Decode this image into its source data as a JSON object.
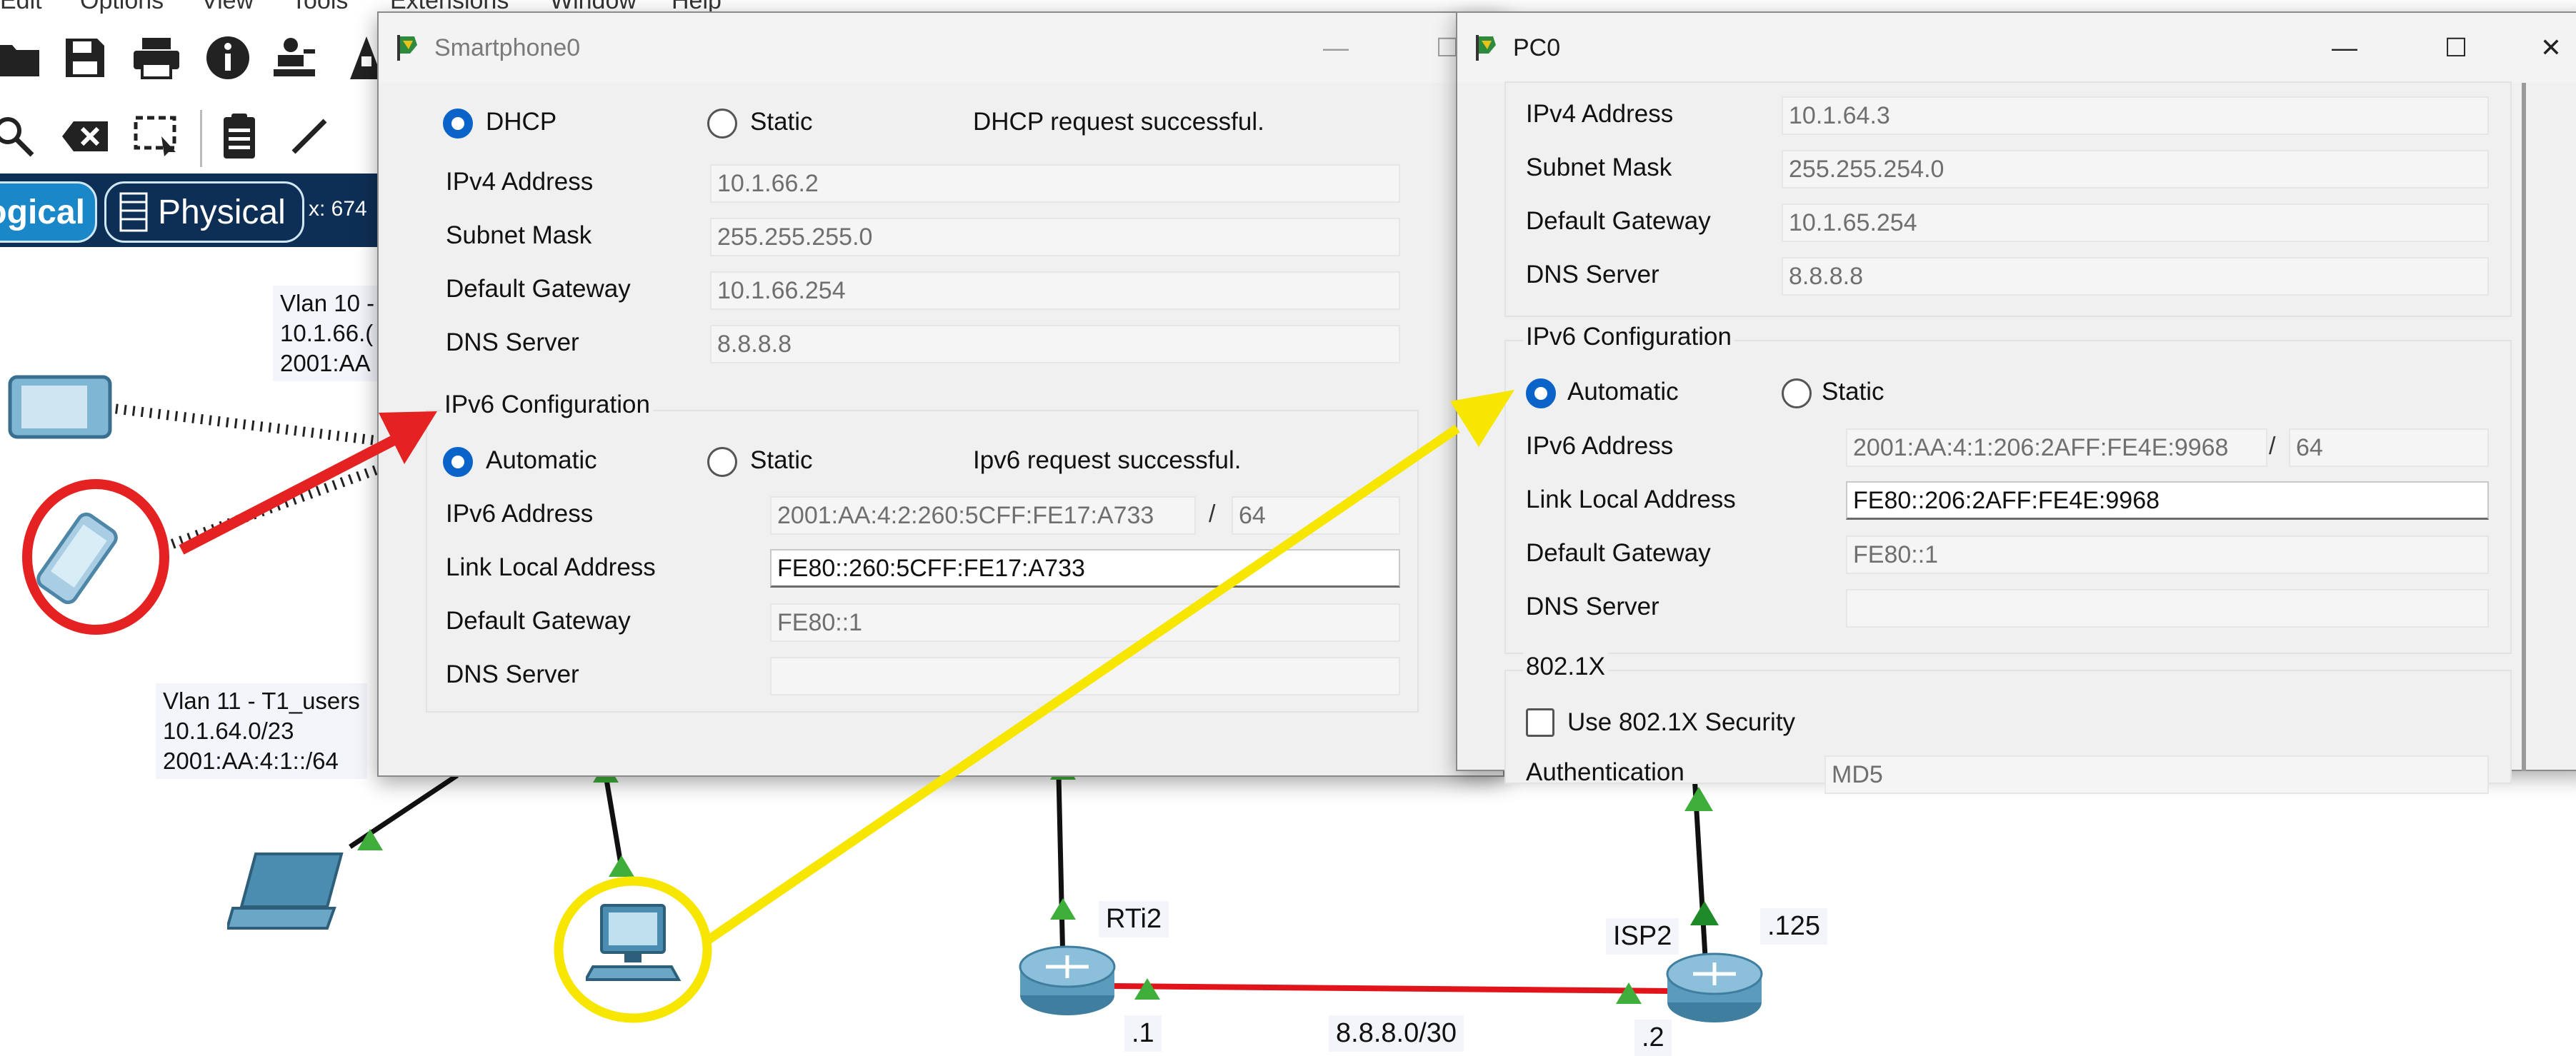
{
  "background_app": {
    "menu": [
      "Edit",
      "Options",
      "View",
      "Tools",
      "Extensions",
      "Window",
      "Help"
    ],
    "toolbar_icons": [
      "folder-icon",
      "save-icon",
      "print-icon",
      "info-icon",
      "network-wizard-icon",
      "palette-icon"
    ],
    "toolbar2_icons": [
      "zoom-icon",
      "delete-icon",
      "select-icon",
      "note-icon",
      "line-icon"
    ],
    "view_tabs": {
      "logical": "ogical",
      "physical": "Physical"
    },
    "coord_readout": "x: 674",
    "notes": [
      {
        "name": "vlan10-note",
        "text": "Vlan 10 -\n10.1.66.(\n2001:AA"
      },
      {
        "name": "vlan11-note",
        "text": "Vlan 11 - T1_users\n10.1.64.0/23\n2001:AA:4:1::/64"
      }
    ],
    "labels": {
      "router1": "RTi2",
      "router2": "ISP2",
      "iface_125": ".125",
      "network": "8.8.8.0/30",
      "iface_1": ".1",
      "iface_2": ".2"
    },
    "link_colors": {
      "serial": "#e0141a",
      "ethernet": "#111111",
      "port_up": "#3fae3a",
      "callout_red": "#e52222",
      "callout_yellow": "#f6e600"
    }
  },
  "smartphone_window": {
    "title": "Smartphone0",
    "ipv4_mode": {
      "dhcp": "DHCP",
      "static": "Static",
      "selected": "DHCP",
      "status": "DHCP request successful."
    },
    "ipv4": {
      "address_label": "IPv4 Address",
      "address": "10.1.66.2",
      "mask_label": "Subnet Mask",
      "mask": "255.255.255.0",
      "gateway_label": "Default Gateway",
      "gateway": "10.1.66.254",
      "dns_label": "DNS Server",
      "dns": "8.8.8.8"
    },
    "ipv6_title": "IPv6 Configuration",
    "ipv6_mode": {
      "automatic": "Automatic",
      "static": "Static",
      "selected": "Automatic",
      "status": "Ipv6 request successful."
    },
    "ipv6": {
      "address_label": "IPv6 Address",
      "address": "2001:AA:4:2:260:5CFF:FE17:A733",
      "slash": "/",
      "prefix": "64",
      "link_local_label": "Link Local Address",
      "link_local": "FE80::260:5CFF:FE17:A733",
      "gateway_label": "Default Gateway",
      "gateway": "FE80::1",
      "dns_label": "DNS Server",
      "dns": ""
    }
  },
  "pc_window": {
    "title": "PC0",
    "ipv4": {
      "address_label": "IPv4 Address",
      "address": "10.1.64.3",
      "mask_label": "Subnet Mask",
      "mask": "255.255.254.0",
      "gateway_label": "Default Gateway",
      "gateway": "10.1.65.254",
      "dns_label": "DNS Server",
      "dns": "8.8.8.8"
    },
    "ipv6_title": "IPv6 Configuration",
    "ipv6_mode": {
      "automatic": "Automatic",
      "static": "Static",
      "selected": "Automatic"
    },
    "ipv6": {
      "address_label": "IPv6 Address",
      "address": "2001:AA:4:1:206:2AFF:FE4E:9968",
      "slash": "/",
      "prefix": "64",
      "link_local_label": "Link Local Address",
      "link_local": "FE80::206:2AFF:FE4E:9968",
      "gateway_label": "Default Gateway",
      "gateway": "FE80::1",
      "dns_label": "DNS Server",
      "dns": ""
    },
    "dot1x_title": "802.1X",
    "dot1x_checkbox": "Use 802.1X Security",
    "auth_label": "Authentication",
    "auth_value": "MD5"
  }
}
